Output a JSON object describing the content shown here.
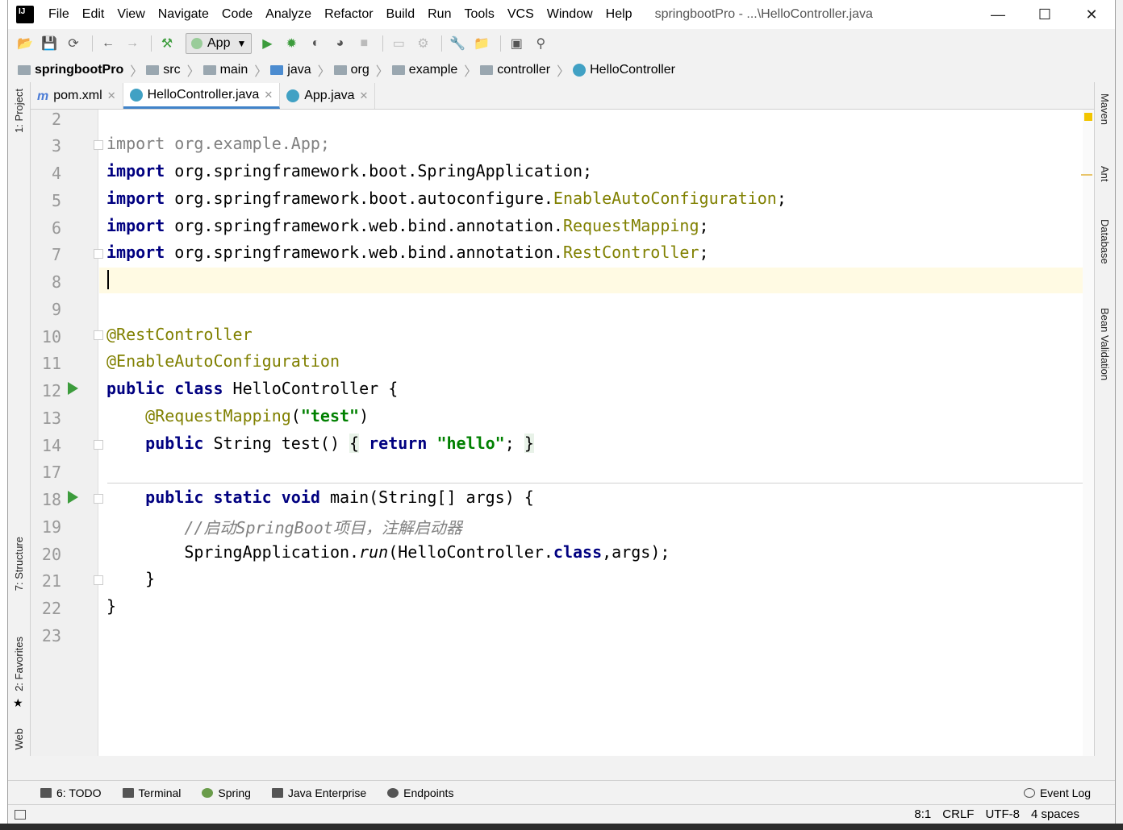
{
  "titlebar": {
    "menus": [
      "File",
      "Edit",
      "View",
      "Navigate",
      "Code",
      "Analyze",
      "Refactor",
      "Build",
      "Run",
      "Tools",
      "VCS",
      "Window",
      "Help"
    ],
    "window_title": "springbootPro - ...\\HelloController.java"
  },
  "toolbar": {
    "run_config": "App"
  },
  "breadcrumbs": [
    "springbootPro",
    "src",
    "main",
    "java",
    "org",
    "example",
    "controller",
    "HelloController"
  ],
  "tabs": [
    {
      "label": "pom.xml",
      "icon": "m"
    },
    {
      "label": "HelloController.java",
      "icon": "c"
    },
    {
      "label": "App.java",
      "icon": "c"
    }
  ],
  "left_tools": [
    "1: Project",
    "7: Structure",
    "2: Favorites",
    "Web"
  ],
  "right_tools": [
    "Maven",
    "Ant",
    "Database",
    "Bean Validation"
  ],
  "line_numbers": [
    "2",
    "3",
    "4",
    "5",
    "6",
    "7",
    "8",
    "9",
    "10",
    "11",
    "12",
    "13",
    "14",
    "17",
    "18",
    "19",
    "20",
    "21",
    "22",
    "23"
  ],
  "code": {
    "import_kw": "import",
    "l3": "org.example.App;",
    "l4": "org.springframework.boot.SpringApplication;",
    "l5a": "org.springframework.boot.autoconfigure.",
    "l5b": "EnableAutoConfiguration",
    "l6a": "org.springframework.web.bind.annotation.",
    "l6b": "RequestMapping",
    "l7a": "org.springframework.web.bind.annotation.",
    "l7b": "RestController",
    "l10": "@RestController",
    "l11": "@EnableAutoConfiguration",
    "l12_kw": "public class",
    "l12_rest": " HelloController {",
    "l13_ann": "@RequestMapping",
    "l13_str": "\"test\"",
    "l14_kw": "public",
    "l14_mid": " String test() ",
    "l14_ret": "return",
    "l14_str": "\"hello\"",
    "l18_kw": "public static void",
    "l18_rest": " main(String[] args) {",
    "l19": "//启动SpringBoot项目，注解启动器",
    "l20_a": "SpringApplication.",
    "l20_run": "run",
    "l20_b": "(HelloController.",
    "l20_cls": "class",
    "l20_c": ",args);",
    "l21": "}",
    "l22": "}"
  },
  "bottom_tools": [
    "6: TODO",
    "Terminal",
    "Spring",
    "Java Enterprise",
    "Endpoints"
  ],
  "event_log": "Event Log",
  "status": {
    "position": "8:1",
    "line_sep": "CRLF",
    "encoding": "UTF-8",
    "indent": "4 spaces"
  }
}
